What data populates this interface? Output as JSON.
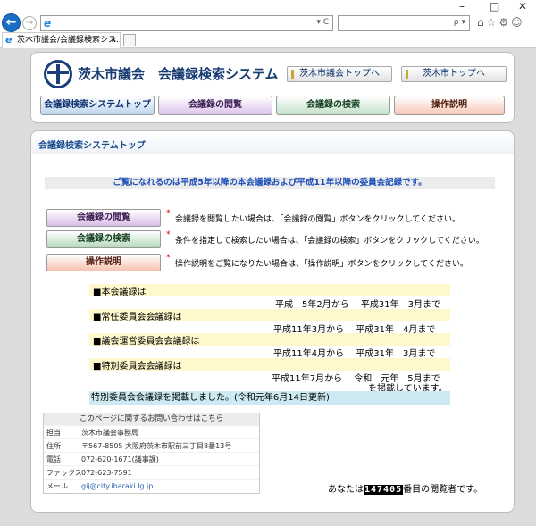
{
  "browser": {
    "window_controls": {
      "minimize": "–",
      "maximize": "□",
      "close": "✕"
    },
    "back_icon": "arrow-left-icon",
    "forward_icon": "arrow-right-icon",
    "address_tools": "▾ C",
    "search_tools": "ρ ▾",
    "toolbar_icons": "⌂☆⚙☺",
    "tab": {
      "title": "茨木市議会/会議録検索シス...",
      "close": "×"
    }
  },
  "header": {
    "site_title": "茨木市議会　会議録検索システム",
    "links": [
      "茨木市議会トップへ",
      "茨木市トップへ"
    ],
    "nav": [
      "会議録検索システムトップ",
      "会議録の閲覧",
      "会議録の検索",
      "操作説明"
    ]
  },
  "content": {
    "heading": "会議録検索システムトップ",
    "notice": "ご覧になれるのは平成5年以降の本会議録および平成11年以降の委員会記録です。",
    "actions": [
      {
        "label": "会議録の閲覧",
        "mark": "*",
        "desc": "会議録を閲覧したい場合は、「会議録の閲覧」ボタンをクリックしてください。"
      },
      {
        "label": "会議録の検索",
        "mark": "*",
        "desc": "条件を指定して検索したい場合は、「会議録の検索」ボタンをクリックしてください。"
      },
      {
        "label": "操作説明",
        "mark": "*",
        "desc": "操作説明をご覧になりたい場合は、「操作説明」ボタンをクリックしてください。"
      }
    ],
    "records": [
      {
        "label": "■本会議録は",
        "period": "平成　5年2月から　 平成31年　3月まで"
      },
      {
        "label": "■常任委員会会議録は",
        "period": "平成11年3月から　 平成31年　4月まで"
      },
      {
        "label": "■議会運営委員会会議録は",
        "period": "平成11年4月から　 平成31年　3月まで"
      },
      {
        "label": "■特別委員会会議録は",
        "period": "平成11年7月から　 令和　元年　5月まで",
        "period2": "を掲載しています。"
      }
    ],
    "note": "特別委員会会議録を掲載しました。(令和元年6月14日更新)"
  },
  "contact": {
    "heading": "このページに関するお問い合わせはこちら",
    "rows": [
      {
        "k": "担当",
        "v": "茨木市議会事務局"
      },
      {
        "k": "住所",
        "v": "〒567-8505 大阪府茨木市駅前三丁目8番13号"
      },
      {
        "k": "電話",
        "v": "072-620-1671(議事課)"
      },
      {
        "k": "ファックス",
        "v": "072-623-7591"
      },
      {
        "k": "メール",
        "v": "gij@city.ibaraki.lg.jp"
      }
    ]
  },
  "counter": {
    "prefix": "あなたは",
    "digits": "147405",
    "suffix": "番目の閲覧者です。"
  }
}
